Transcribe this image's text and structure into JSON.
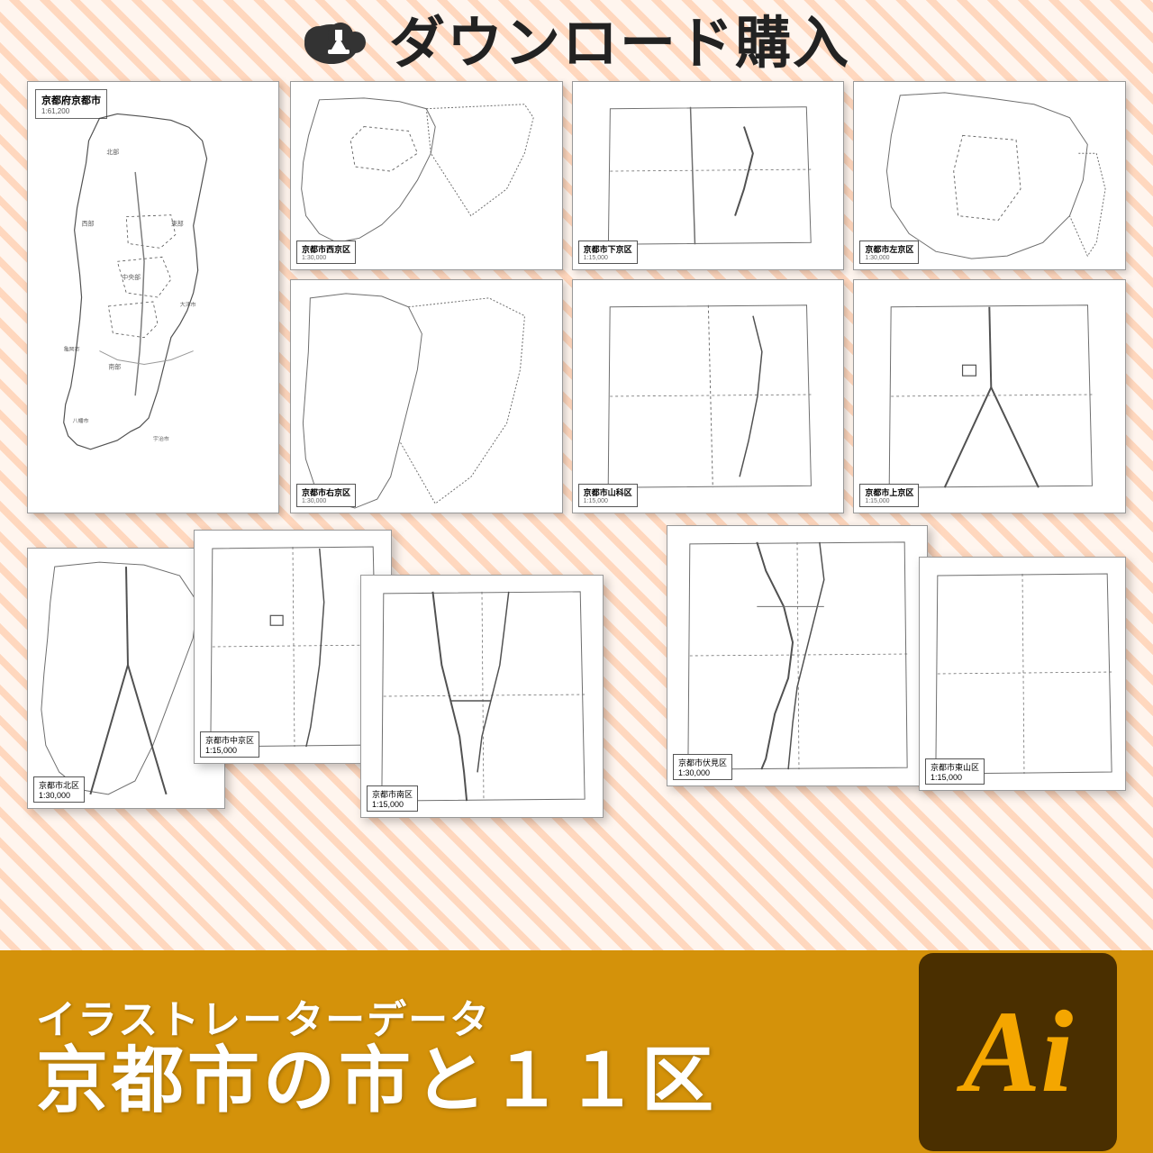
{
  "header": {
    "icon": "cloud-download-icon",
    "title": "ダウンロード購入"
  },
  "large_map": {
    "title": "京都府京都市",
    "scale": "1:61,200"
  },
  "maps": [
    {
      "id": "nishiku",
      "title": "京都市西京区",
      "scale": "1:30,000",
      "position": "top-left-small"
    },
    {
      "id": "shimogyo",
      "title": "京都市下京区",
      "scale": "1:15,000",
      "position": "top-mid-small"
    },
    {
      "id": "sakyoku",
      "title": "京都市左京区",
      "scale": "1:30,000",
      "position": "top-right-small"
    },
    {
      "id": "ukyoku",
      "title": "京都市右京区",
      "scale": "1:30,000",
      "position": "mid-left-tall"
    },
    {
      "id": "yamashina",
      "title": "京都市山科区",
      "scale": "1:15,000",
      "position": "mid-mid-small"
    },
    {
      "id": "kamigyo",
      "title": "京都市上京区",
      "scale": "1:15,000",
      "position": "mid-right-small"
    },
    {
      "id": "kitaku",
      "title": "京都市北区",
      "scale": "1:30,000",
      "position": "bottom-far-left"
    },
    {
      "id": "nakagyo",
      "title": "京都市中京区",
      "scale": "1:15,000",
      "position": "bottom-left"
    },
    {
      "id": "minamiku",
      "title": "京都市南区",
      "scale": "1:15,000",
      "position": "bottom-mid"
    },
    {
      "id": "fushimi",
      "title": "京都市伏見区",
      "scale": "1:30,000",
      "position": "bottom-right"
    },
    {
      "id": "higashiyama",
      "title": "京都市東山区",
      "scale": "1:15,000",
      "position": "bottom-far-right"
    }
  ],
  "footer": {
    "line1": "イラストレーターデータ",
    "line2": "京都市の市と１１区",
    "badge_text": "Ai"
  }
}
